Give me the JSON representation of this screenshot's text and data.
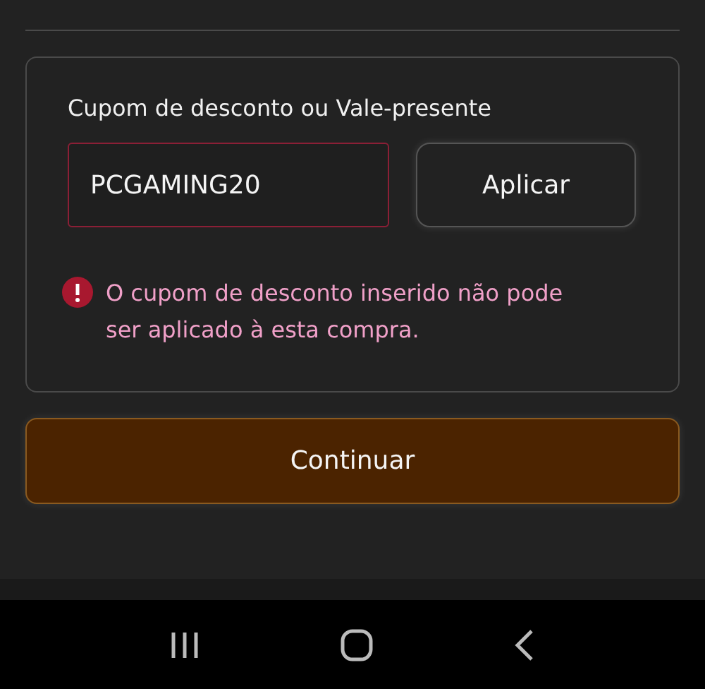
{
  "coupon": {
    "label": "Cupom de desconto ou Vale-presente",
    "value": "PCGAMING20",
    "error": true,
    "apply_button": "Aplicar",
    "error_message": "O cupom de desconto inserido não pode ser aplicado à esta compra."
  },
  "continue_button": "Continuar"
}
